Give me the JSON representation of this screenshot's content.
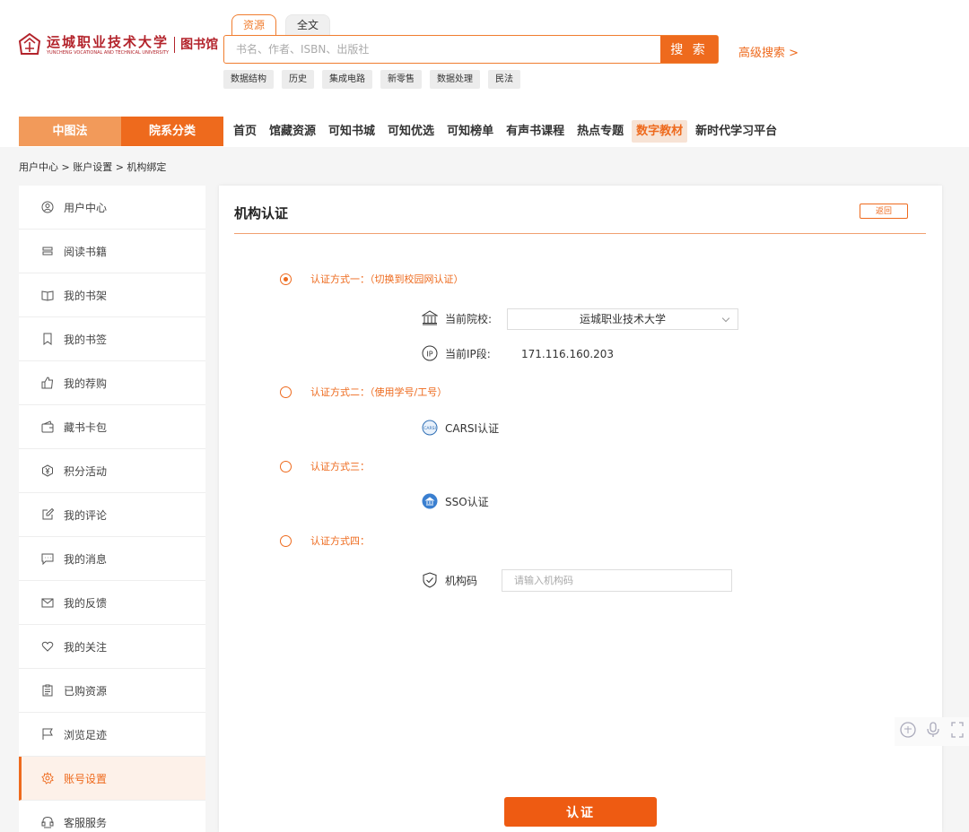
{
  "header": {
    "logo_cn": "运城职业技术大学",
    "logo_en": "YUNCHENG VOCATIONAL AND TECHNICAL UNIVERSITY",
    "logo_lib": "图书馆",
    "search_tabs": [
      "资源",
      "全文"
    ],
    "search_placeholder": "书名、作者、ISBN、出版社",
    "search_button": "搜 索",
    "advanced_search": "高级搜索 >",
    "hot_tags": [
      "数据结构",
      "历史",
      "集成电路",
      "新零售",
      "数据处理",
      "民法"
    ]
  },
  "nav": {
    "category_a": "中图法",
    "category_b": "院系分类",
    "links": [
      "首页",
      "馆藏资源",
      "可知书城",
      "可知优选",
      "可知榜单",
      "有声书课程",
      "热点专题",
      "数字教材",
      "新时代学习平台"
    ],
    "highlighted": "数字教材"
  },
  "breadcrumb": "用户中心 > 账户设置 > 机构绑定",
  "sidebar": {
    "items": [
      {
        "label": "用户中心",
        "icon": "user-circle-icon"
      },
      {
        "label": "阅读书籍",
        "icon": "book-stack-icon"
      },
      {
        "label": "我的书架",
        "icon": "open-book-icon"
      },
      {
        "label": "我的书签",
        "icon": "bookmark-icon"
      },
      {
        "label": "我的荐购",
        "icon": "thumb-up-icon"
      },
      {
        "label": "藏书卡包",
        "icon": "wallet-icon"
      },
      {
        "label": "积分活动",
        "icon": "yen-badge-icon"
      },
      {
        "label": "我的评论",
        "icon": "edit-icon"
      },
      {
        "label": "我的消息",
        "icon": "message-icon"
      },
      {
        "label": "我的反馈",
        "icon": "mail-icon"
      },
      {
        "label": "我的关注",
        "icon": "heart-icon"
      },
      {
        "label": "已购资源",
        "icon": "clipboard-icon"
      },
      {
        "label": "浏览足迹",
        "icon": "flag-icon"
      },
      {
        "label": "账号设置",
        "icon": "gear-icon"
      },
      {
        "label": "客服服务",
        "icon": "headset-icon"
      }
    ],
    "active_index": 13
  },
  "panel": {
    "title": "机构认证",
    "back": "返回",
    "method1": "认证方式一：（切换到校园网认证）",
    "current_school_label": "当前院校:",
    "current_school_value": "运城职业技术大学",
    "ip_label": "当前IP段:",
    "ip_value": "171.116.160.203",
    "method2": "认证方式二：（使用学号/工号）",
    "carsi": "CARSI认证",
    "method3": "认证方式三：",
    "sso": "SSO认证",
    "method4": "认证方式四：",
    "org_code_label": "机构码",
    "org_code_placeholder": "请输入机构码",
    "submit": "认证",
    "carsi_badge": "CARSI",
    "ip_badge": "IP"
  },
  "colors": {
    "accent": "#ee6a1d",
    "accent_light": "#f29a5a",
    "brand_red": "#b3232b"
  }
}
